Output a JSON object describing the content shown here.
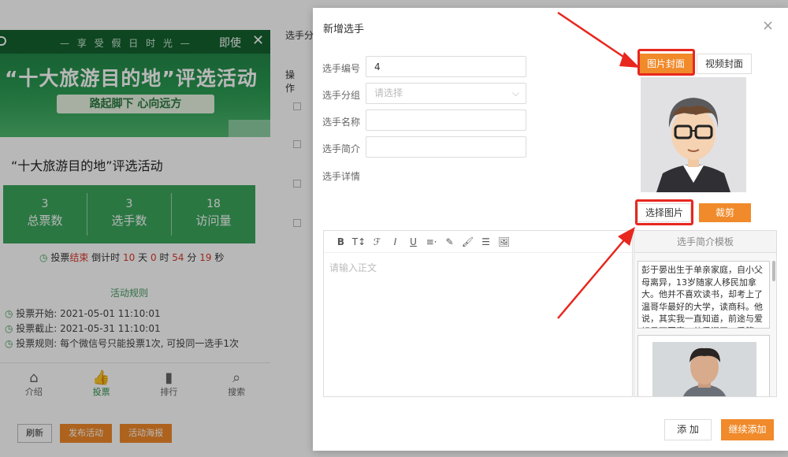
{
  "background": {
    "banner": {
      "tagline": "— 享 受 假 日 时 光 —",
      "right_title": "即使",
      "close": "✕",
      "big_title": "“十大旅游目的地”评选活动",
      "ribbon": "路起脚下 心向远方"
    },
    "activity_name": "“十大旅游目的地”评选活动",
    "stats": [
      {
        "num": "3",
        "label": "总票数"
      },
      {
        "num": "3",
        "label": "选手数"
      },
      {
        "num": "18",
        "label": "访问量"
      }
    ],
    "countdown": {
      "prefix": "投票",
      "status": "结束",
      "label": "倒计时",
      "days": "10",
      "d_unit": "天",
      "hours": "0",
      "h_unit": "时",
      "minutes": "54",
      "m_unit": "分",
      "seconds": "19",
      "s_unit": "秒"
    },
    "rules": {
      "title": "活动规则",
      "start": "投票开始: 2021-05-01 11:10:01",
      "end": "投票截止: 2021-05-31 11:10:01",
      "rule": "投票规则: 每个微信号只能投票1次, 可投同一选手1次"
    },
    "tabs": [
      {
        "icon": "⌂",
        "label": "介绍"
      },
      {
        "icon": "👍",
        "label": "投票"
      },
      {
        "icon": "▮",
        "label": "排行"
      },
      {
        "icon": "⌕",
        "label": "搜索"
      }
    ],
    "buttons": {
      "refresh": "刷新",
      "publish": "发布活动",
      "poster": "活动海报"
    },
    "right": {
      "col1": "选手分",
      "col2": "操作"
    }
  },
  "modal": {
    "title": "新增选手",
    "close": "×",
    "fields": {
      "number_label": "选手编号",
      "number_value": "4",
      "group_label": "选手分组",
      "group_placeholder": "请选择",
      "name_label": "选手名称",
      "intro_label": "选手简介",
      "detail_label": "选手详情"
    },
    "cover_tabs": {
      "image": "图片封面",
      "video": "视频封面"
    },
    "image_buttons": {
      "select": "选择图片",
      "crop": "裁剪"
    },
    "editor": {
      "placeholder": "请输入正文",
      "tools": [
        "B",
        "T↕",
        "ℱ",
        "I",
        "U",
        "≡·",
        "✎",
        "🖌",
        "☰",
        "🖼"
      ]
    },
    "template": {
      "title": "选手简介模板",
      "text": "彭于晏出生于单亲家庭，自小父母离异，13岁随家人移民加拿大。他并不喜欢读书，却考上了温哥华最好的大学，读商科。他说，其实我一直知道，前途与爱好是两回事。他爱漫画，爱篮球，但在看不"
    },
    "footer": {
      "add": "添 加",
      "continue": "继续添加"
    }
  },
  "colors": {
    "accent": "#f08a2a",
    "highlight": "#e8271f",
    "green": "#3ba55c"
  }
}
